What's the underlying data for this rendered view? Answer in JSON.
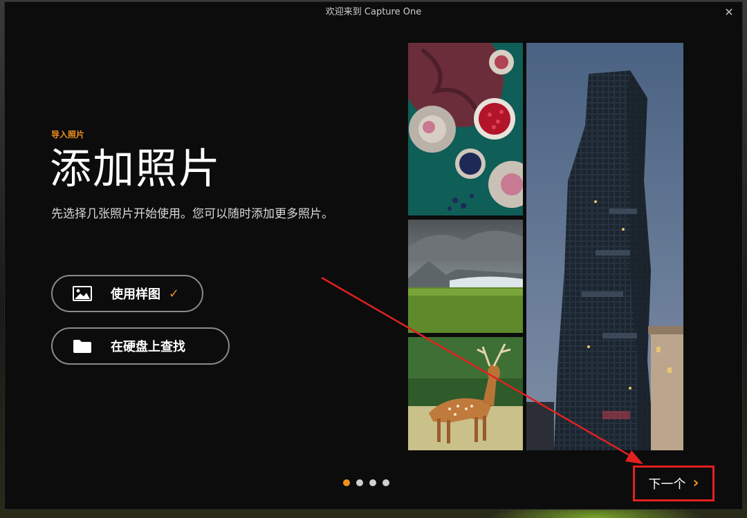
{
  "window": {
    "title": "欢迎来到 Capture One",
    "close_glyph": "✕"
  },
  "content": {
    "eyebrow": "导入照片",
    "headline": "添加照片",
    "description": "先选择几张照片开始使用。您可以随时添加更多照片。"
  },
  "actions": {
    "sample": {
      "label": "使用样图",
      "icon": "image-icon",
      "check": "✓"
    },
    "disk": {
      "label": "在硬盘上查找",
      "icon": "folder-icon"
    }
  },
  "collage": {
    "images": [
      "food-photo",
      "glacier-landscape-photo",
      "deer-photo",
      "skyscraper-photo"
    ]
  },
  "pager": {
    "pages": 4,
    "active_index": 0
  },
  "next": {
    "label": "下一个",
    "chevron": "›"
  },
  "colors": {
    "accent": "#f0901e",
    "annotation": "#e32020",
    "background": "#0c0c0c",
    "pill_border": "#8a8a8a"
  }
}
